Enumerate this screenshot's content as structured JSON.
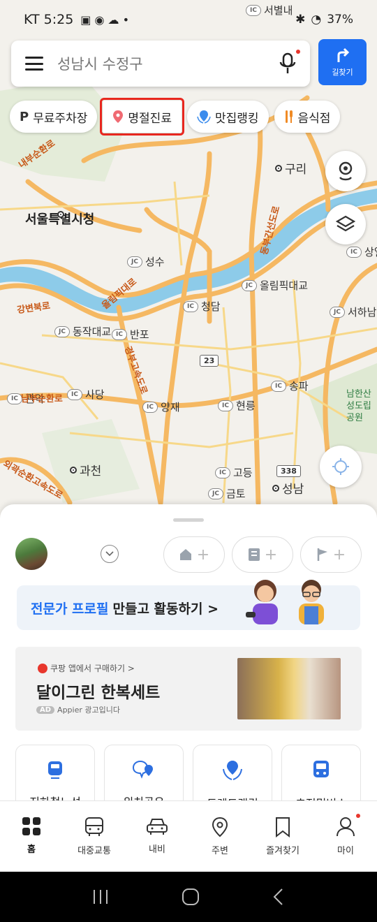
{
  "status_bar": {
    "carrier_time": "KT 5:25",
    "battery": "37%"
  },
  "search": {
    "placeholder": "성남시 수정구",
    "directions_label": "길찾기"
  },
  "chips": [
    {
      "icon": "parking-icon",
      "label": "무료주차장"
    },
    {
      "icon": "pin-icon",
      "label": "명절진료"
    },
    {
      "icon": "ranking-icon",
      "label": "맛집랭킹"
    },
    {
      "icon": "restaurant-icon",
      "label": "음식점"
    }
  ],
  "map": {
    "places": [
      "서울특별시청",
      "구리",
      "과천",
      "성남"
    ],
    "ic_labels": [
      "성수",
      "청담",
      "반포",
      "동작대교",
      "사당",
      "관악",
      "양재",
      "현릉",
      "송파",
      "고등",
      "금토",
      "올림픽대교",
      "서하남",
      "상일"
    ],
    "road_labels": [
      "내부순환로",
      "강변북로",
      "올림픽대로",
      "경부고속도로",
      "동부간선도로",
      "남부순환로",
      "외곽순환고속도로"
    ],
    "route_badges": [
      "23",
      "338"
    ],
    "partial_labels": [
      "서별내",
      "남한산성도립공원"
    ]
  },
  "sheet": {
    "banner_blue": "전문가 프로필",
    "banner_rest": "만들고 활동하기 >",
    "ad": {
      "source": "쿠팡 앱에서 구매하기 >",
      "title": "달이그린 한복세트",
      "ad_tag": "AD",
      "note": "Appier 광고입니다"
    },
    "tiles": [
      "지하철노선",
      "위치공유",
      "트렌드랭킹",
      "초정밀버스"
    ]
  },
  "nav": [
    {
      "icon": "home-grid-icon",
      "label": "홈"
    },
    {
      "icon": "bus-icon",
      "label": "대중교통"
    },
    {
      "icon": "car-icon",
      "label": "내비"
    },
    {
      "icon": "location-pin-icon",
      "label": "주변"
    },
    {
      "icon": "bookmark-icon",
      "label": "즐겨찾기"
    },
    {
      "icon": "person-icon",
      "label": "마이"
    }
  ],
  "colors": {
    "accent": "#1f6ff2",
    "highlight": "#e8271f",
    "river": "#7fc2e6",
    "road": "#f5b862"
  }
}
